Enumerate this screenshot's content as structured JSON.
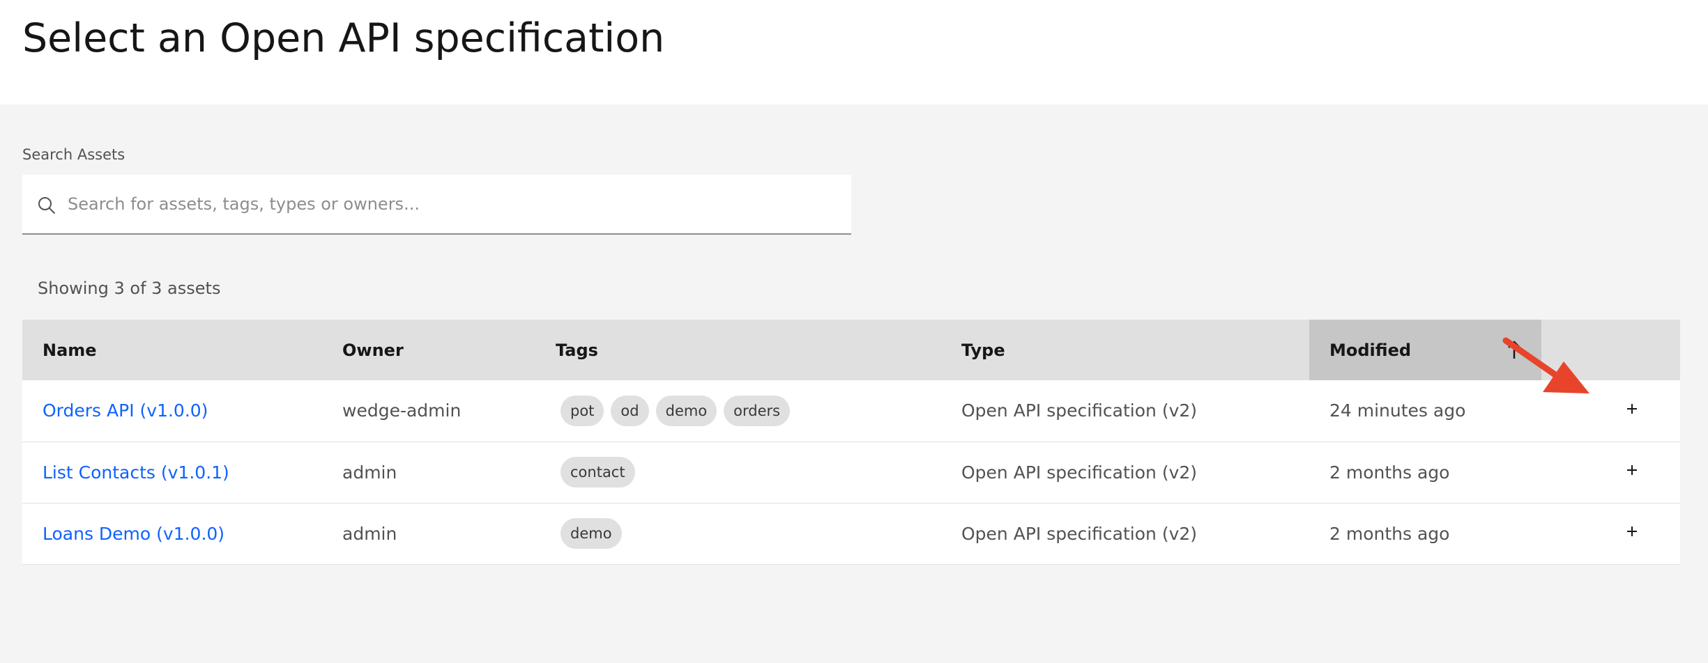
{
  "page": {
    "title": "Select an Open API specification"
  },
  "search": {
    "label": "Search Assets",
    "placeholder": "Search for assets, tags, types or owners...",
    "value": ""
  },
  "results": {
    "count_text": "Showing 3 of 3 assets"
  },
  "table": {
    "columns": {
      "name": "Name",
      "owner": "Owner",
      "tags": "Tags",
      "type": "Type",
      "modified": "Modified"
    },
    "rows": [
      {
        "name": "Orders API (v1.0.0)",
        "owner": "wedge-admin",
        "tags": [
          "pot",
          "od",
          "demo",
          "orders"
        ],
        "type": "Open API specification (v2)",
        "modified": "24 minutes ago",
        "action": "+"
      },
      {
        "name": "List Contacts (v1.0.1)",
        "owner": "admin",
        "tags": [
          "contact"
        ],
        "type": "Open API specification (v2)",
        "modified": "2 months ago",
        "action": "+"
      },
      {
        "name": "Loans Demo (v1.0.0)",
        "owner": "admin",
        "tags": [
          "demo"
        ],
        "type": "Open API specification (v2)",
        "modified": "2 months ago",
        "action": "+"
      }
    ]
  },
  "icons": {
    "search": "search-icon",
    "sort": "sort-arrow-up-icon",
    "add": "plus-icon",
    "annotation": "red-arrow-annotation"
  },
  "colors": {
    "link": "#0f62fe",
    "header_bg": "#e0e0e0",
    "sorted_header_bg": "#c6c6c6",
    "annotation": "#e8442b"
  }
}
